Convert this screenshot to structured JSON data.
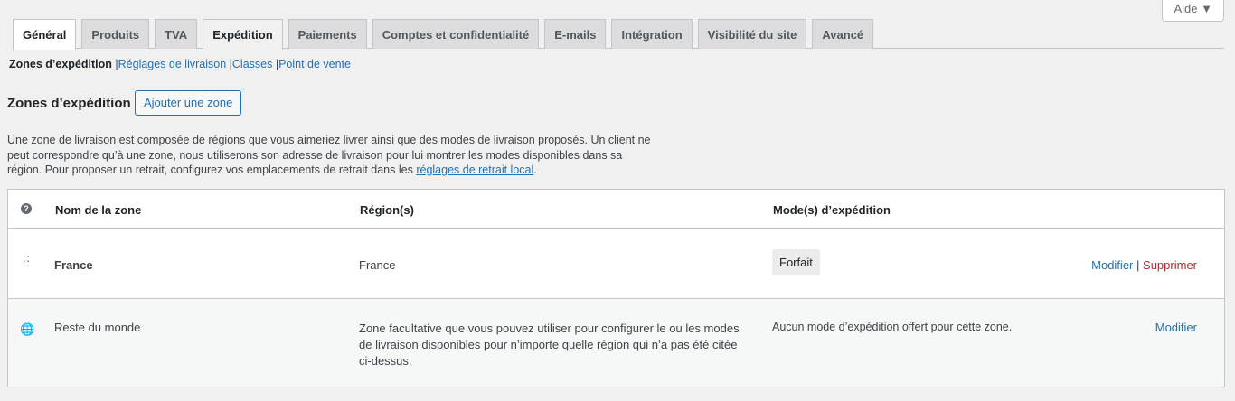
{
  "help_label": "Aide",
  "tabs": [
    "Général",
    "Produits",
    "TVA",
    "Expédition",
    "Paiements",
    "Comptes et confidentialité",
    "E-mails",
    "Intégration",
    "Visibilité du site",
    "Avancé"
  ],
  "subnav": {
    "current": "Zones d’expédition",
    "links": [
      "Réglages de livraison",
      "Classes",
      "Point de vente"
    ]
  },
  "heading": "Zones d’expédition",
  "add_button": "Ajouter une zone",
  "description": {
    "text": "Une zone de livraison est composée de régions que vous aimeriez livrer ainsi que des modes de livraison proposés. Un client ne peut correspondre qu’à une zone, nous utiliserons son adresse de livraison pour lui montrer les modes disponibles dans sa région. Pour proposer un retrait, configurez vos emplacements de retrait dans les ",
    "link": "réglages de retrait local",
    "end": "."
  },
  "table": {
    "headers": [
      "Nom de la zone",
      "Région(s)",
      "Mode(s) d’expédition"
    ],
    "rows": [
      {
        "name": "France",
        "region": "France",
        "method": "Forfait",
        "edit": "Modifier",
        "sep": "|",
        "delete": "Supprimer"
      },
      {
        "name": "Reste du monde",
        "region": "Zone facultative que vous pouvez utiliser pour configurer le ou les modes de livraison disponibles pour n’importe quelle région qui n’a pas été citée ci-dessus.",
        "method": "Aucun mode d’expédition offert pour cette zone.",
        "edit": "Modifier"
      }
    ]
  }
}
